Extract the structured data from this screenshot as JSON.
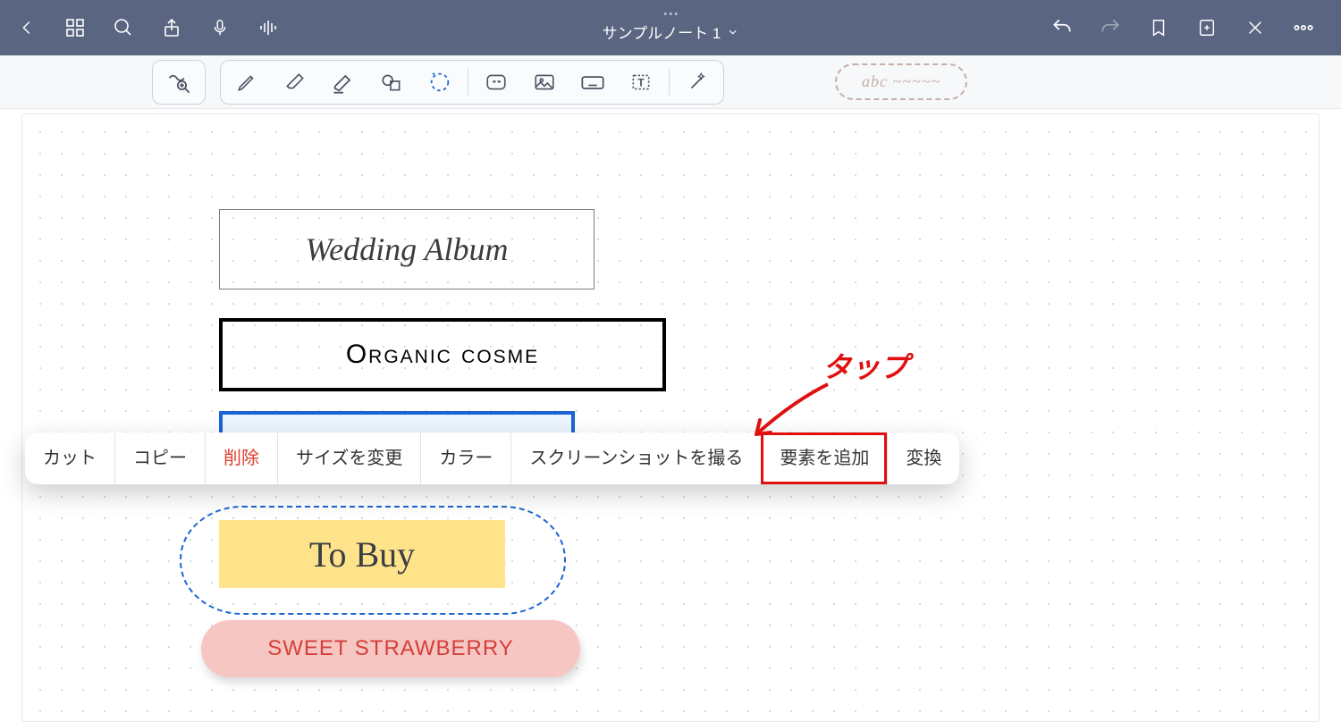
{
  "header": {
    "title": "サンプルノート 1"
  },
  "toolbar": {
    "search_placeholder": "abc ~~~~~"
  },
  "canvas": {
    "box1": "Wedding Album",
    "box2": "Organic cosme",
    "box3": "",
    "box4": "To Buy",
    "box5": "SWEET STRAWBERRY"
  },
  "context_menu": {
    "cut": "カット",
    "copy": "コピー",
    "delete": "削除",
    "resize": "サイズを変更",
    "color": "カラー",
    "screenshot": "スクリーンショットを撮る",
    "add_element": "要素を追加",
    "convert": "変換"
  },
  "annotation": {
    "tap": "タップ"
  }
}
